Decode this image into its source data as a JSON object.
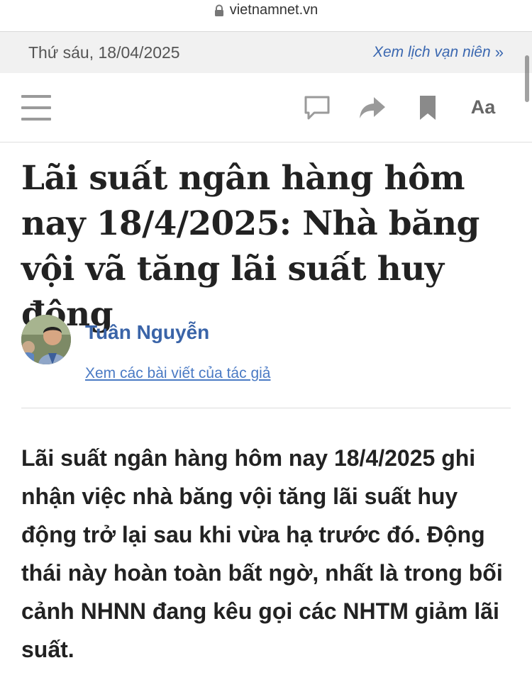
{
  "browser": {
    "host": "vietnamnet.vn",
    "lock_icon": "lock-icon"
  },
  "datebar": {
    "date": "Thứ sáu, 18/04/2025",
    "lunar_link": "Xem lịch vạn niên",
    "chevron": "»"
  },
  "toolbar": {
    "menu_icon": "hamburger-menu-icon",
    "comment_icon": "comment-icon",
    "share_icon": "share-icon",
    "bookmark_icon": "bookmark-icon",
    "font_size_label": "Aa"
  },
  "article": {
    "title": "Lãi suất ngân hàng hôm nay 18/4/2025: Nhà băng vội vã tăng lãi suất huy động",
    "author": {
      "name": "Tuân Nguyễn",
      "link_text": "Xem các bài viết của tác giả"
    },
    "lead": "Lãi suất ngân hàng hôm nay 18/4/2025 ghi nhận việc nhà băng vội tăng lãi suất huy động trở lại sau khi vừa hạ trước đó. Động thái này hoàn toàn bất ngờ, nhất là trong bối cảnh NHNN đang kêu gọi các NHTM giảm lãi suất."
  },
  "colors": {
    "accent_link": "#3a67b0",
    "date_strip_bg": "#f1f1f1",
    "icon_gray": "#9a9a9a"
  }
}
